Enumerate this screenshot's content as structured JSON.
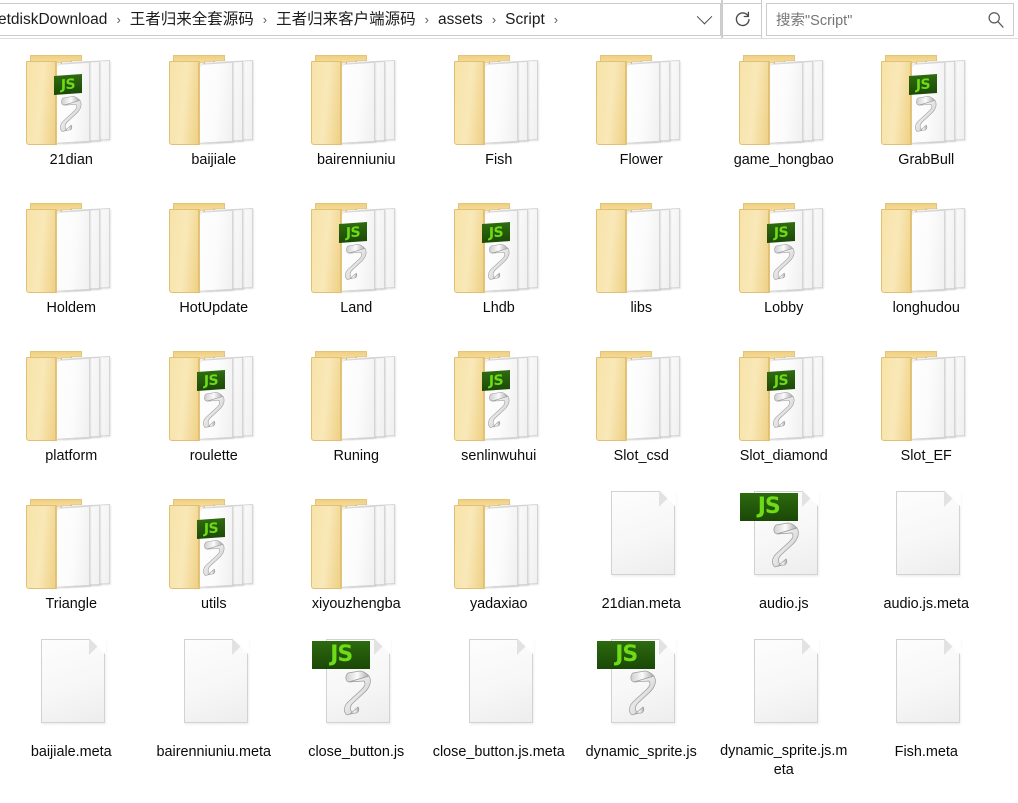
{
  "window": {
    "type": "file-explorer",
    "view": "large-icons"
  },
  "addressbar": {
    "breadcrumbs": [
      {
        "label": "etdiskDownload",
        "clipped": true
      },
      {
        "label": "王者归来全套源码",
        "clipped": false
      },
      {
        "label": "王者归来客户端源码",
        "clipped": false
      },
      {
        "label": "assets",
        "clipped": false
      },
      {
        "label": "Script",
        "clipped": false
      }
    ],
    "separator": "›",
    "dropdown_icon": "chevron-down-icon",
    "refresh_icon": "refresh-icon",
    "search_placeholder": "搜索\"Script\"",
    "search_icon": "search-icon"
  },
  "colors": {
    "folder_yellow": "#f7e3a8",
    "folder_yellow_dark": "#e0c173",
    "js_badge_bg": "#1d4d0a",
    "js_badge_text": "#6ddb16",
    "page_white": "#fafafa",
    "text": "#0b0b0b",
    "placeholder": "#767676",
    "border": "#cccccc"
  },
  "files": [
    {
      "name": "21dian",
      "type": "folder",
      "has_js": true
    },
    {
      "name": "baijiale",
      "type": "folder",
      "has_js": false
    },
    {
      "name": "bairenniuniu",
      "type": "folder",
      "has_js": false
    },
    {
      "name": "Fish",
      "type": "folder",
      "has_js": false
    },
    {
      "name": "Flower",
      "type": "folder",
      "has_js": false
    },
    {
      "name": "game_hongbao",
      "type": "folder",
      "has_js": false
    },
    {
      "name": "GrabBull",
      "type": "folder",
      "has_js": true
    },
    {
      "name": "Holdem",
      "type": "folder",
      "has_js": false
    },
    {
      "name": "HotUpdate",
      "type": "folder",
      "has_js": false
    },
    {
      "name": "Land",
      "type": "folder",
      "has_js": true
    },
    {
      "name": "Lhdb",
      "type": "folder",
      "has_js": true
    },
    {
      "name": "libs",
      "type": "folder",
      "has_js": false
    },
    {
      "name": "Lobby",
      "type": "folder",
      "has_js": true
    },
    {
      "name": "longhudou",
      "type": "folder",
      "has_js": false
    },
    {
      "name": "platform",
      "type": "folder",
      "has_js": false
    },
    {
      "name": "roulette",
      "type": "folder",
      "has_js": true
    },
    {
      "name": "Runing",
      "type": "folder",
      "has_js": false
    },
    {
      "name": "senlinwuhui",
      "type": "folder",
      "has_js": true
    },
    {
      "name": "Slot_csd",
      "type": "folder",
      "has_js": false
    },
    {
      "name": "Slot_diamond",
      "type": "folder",
      "has_js": true
    },
    {
      "name": "Slot_EF",
      "type": "folder",
      "has_js": false
    },
    {
      "name": "Triangle",
      "type": "folder",
      "has_js": false
    },
    {
      "name": "utils",
      "type": "folder",
      "has_js": true
    },
    {
      "name": "xiyouzhengba",
      "type": "folder",
      "has_js": false
    },
    {
      "name": "yadaxiao",
      "type": "folder",
      "has_js": false
    },
    {
      "name": "21dian.meta",
      "type": "meta",
      "has_js": false
    },
    {
      "name": "audio.js",
      "type": "js",
      "has_js": true
    },
    {
      "name": "audio.js.meta",
      "type": "meta",
      "has_js": false
    },
    {
      "name": "baijiale.meta",
      "type": "meta",
      "has_js": false
    },
    {
      "name": "bairenniuniu.meta",
      "type": "meta",
      "has_js": false
    },
    {
      "name": "close_button.js",
      "type": "js",
      "has_js": true
    },
    {
      "name": "close_button.js.meta",
      "type": "meta",
      "has_js": false
    },
    {
      "name": "dynamic_sprite.js",
      "type": "js",
      "has_js": true
    },
    {
      "name": "dynamic_sprite.js.meta",
      "type": "meta",
      "has_js": false
    },
    {
      "name": "Fish.meta",
      "type": "meta",
      "has_js": false
    }
  ],
  "js_badge_label": "JS",
  "grid": {
    "columns": 7,
    "rows": 5
  }
}
